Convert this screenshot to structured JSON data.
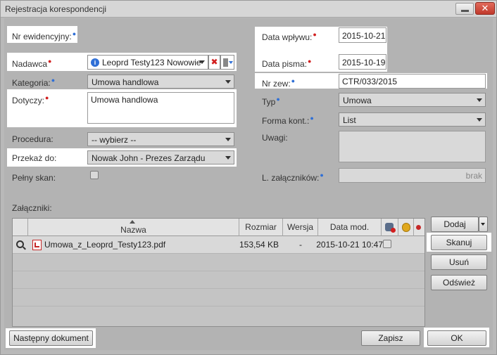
{
  "window": {
    "title": "Rejestracja korespondencji",
    "close_label": "✕"
  },
  "form": {
    "nr_ewidencyjny_label": "Nr ewidencyjny:",
    "nadawca_label": "Nadawca",
    "nadawca_value": "Leoprd Testy123 Nowowie",
    "kategoria_label": "Kategoria:",
    "kategoria_value": "Umowa handlowa",
    "dotyczy_label": "Dotyczy:",
    "dotyczy_value": "Umowa handlowa",
    "procedura_label": "Procedura:",
    "procedura_value": "-- wybierz --",
    "przekaz_label": "Przekaż do:",
    "przekaz_value": "Nowak John - Prezes Zarządu",
    "pelny_skan_label": "Pełny skan:",
    "pelny_skan_checked": false,
    "data_wplywu_label": "Data wpływu:",
    "data_wplywu_value": "2015-10-21",
    "data_pisma_label": "Data pisma:",
    "data_pisma_value": "2015-10-19",
    "nr_zew_label": "Nr  zew:",
    "nr_zew_value": "CTR/033/2015",
    "typ_label": "Typ",
    "typ_value": "Umowa",
    "forma_kont_label": "Forma kont.:",
    "forma_kont_value": "List",
    "uwagi_label": "Uwagi:",
    "uwagi_value": "",
    "l_zalacznikow_label": "L. załączników:",
    "l_zalacznikow_value": "brak"
  },
  "attachments": {
    "label": "Załączniki:",
    "columns": [
      "Nazwa",
      "Rozmiar",
      "Wersja",
      "Data mod."
    ],
    "rows": [
      {
        "name": "Umowa_z_Leoprd_Testy123.pdf",
        "size": "153,54 KB",
        "version": "-",
        "modified": "2015-10-21 10:47",
        "checked": false
      }
    ]
  },
  "side_buttons": {
    "dodaj": "Dodaj",
    "skanuj": "Skanuj",
    "usun": "Usuń",
    "odswiez": "Odśwież"
  },
  "footer": {
    "next_document": "Następny dokument",
    "save": "Zapisz",
    "ok": "OK"
  },
  "colors": {
    "required_marker": "#d21f1f",
    "info_marker": "#2f6fd6",
    "pdf_icon": "#c62828"
  }
}
